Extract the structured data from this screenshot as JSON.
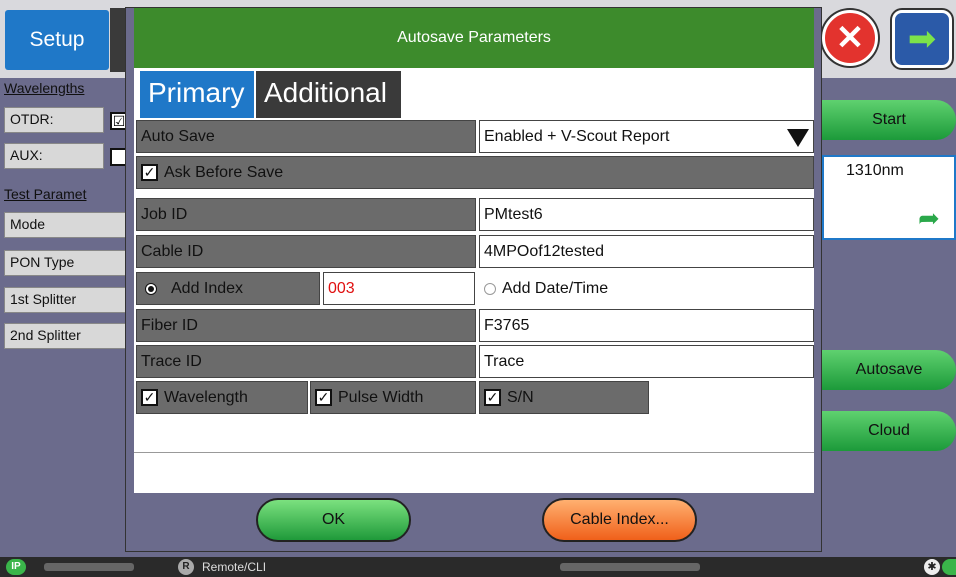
{
  "background": {
    "setup_tab": "Setup",
    "left_panel": {
      "wavelengths_label": "Wavelengths",
      "otdr_label": "OTDR:",
      "aux_label": "AUX:",
      "test_params_label": "Test Paramet",
      "mode_label": "Mode",
      "pon_type_label": "PON Type",
      "splitter1_label": "1st Splitter",
      "splitter2_label": "2nd Splitter"
    },
    "right_panel": {
      "start_label": "Start",
      "wavelength_value": "1310nm",
      "autosave_label": "Autosave",
      "cloud_label": "Cloud"
    },
    "statusbar": {
      "ip_badge": "IP",
      "r_badge": "R",
      "remote_label": "Remote/CLI"
    }
  },
  "dialog": {
    "title": "Autosave Parameters",
    "tabs": [
      "Primary",
      "Additional"
    ],
    "auto_save": {
      "label": "Auto Save",
      "value": "Enabled + V-Scout Report"
    },
    "ask_before_save": {
      "label": "Ask Before Save",
      "checked": true
    },
    "job_id": {
      "label": "Job ID",
      "value": "PMtest6"
    },
    "cable_id": {
      "label": "Cable ID",
      "value": "4MPOof12tested"
    },
    "add_index": {
      "label": "Add Index",
      "value": "003",
      "selected": true
    },
    "add_datetime": {
      "label": "Add Date/Time",
      "selected": false
    },
    "fiber_id": {
      "label": "Fiber ID",
      "value": "F3765"
    },
    "trace_id": {
      "label": "Trace ID",
      "value": "Trace"
    },
    "options": [
      {
        "label": "Wavelength",
        "checked": true
      },
      {
        "label": "Pulse Width",
        "checked": true
      },
      {
        "label": "S/N",
        "checked": true
      }
    ],
    "buttons": {
      "ok": "OK",
      "cable_index": "Cable Index..."
    }
  },
  "colors": {
    "title_green": "#3d8b2c",
    "tab_blue": "#1f78c8",
    "index_red": "#e01010"
  }
}
